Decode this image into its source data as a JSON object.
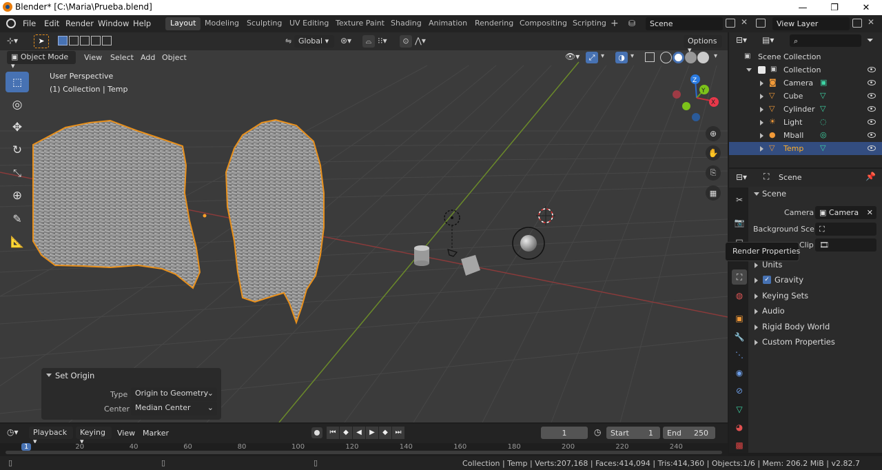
{
  "window": {
    "title": "Blender* [C:\\Maria\\Prueba.blend]",
    "minimize": "—",
    "restore": "❐",
    "close": "✕"
  },
  "menu": {
    "file": "File",
    "edit": "Edit",
    "render": "Render",
    "window": "Window",
    "help": "Help"
  },
  "workspaces": [
    "Layout",
    "Modeling",
    "Sculpting",
    "UV Editing",
    "Texture Paint",
    "Shading",
    "Animation",
    "Rendering",
    "Compositing",
    "Scripting"
  ],
  "active_workspace": "Layout",
  "scene_field": "Scene",
  "view_layer_field": "View Layer",
  "viewport_header": {
    "transform_orientation": "Global",
    "options": "Options",
    "mode": "Object Mode",
    "view": "View",
    "select": "Select",
    "add": "Add",
    "object": "Object"
  },
  "viewport_overlay": {
    "perspective": "User Perspective",
    "collection_info": "(1) Collection | Temp"
  },
  "gizmo": {
    "z": "Z",
    "y": "Y",
    "x": "X"
  },
  "set_origin": {
    "title": "Set Origin",
    "type_label": "Type",
    "type_value": "Origin to Geometry",
    "center_label": "Center",
    "center_value": "Median Center"
  },
  "outliner": {
    "scene_collection": "Scene Collection",
    "collection": "Collection",
    "items": [
      {
        "name": "Camera",
        "selected": false
      },
      {
        "name": "Cube",
        "selected": false
      },
      {
        "name": "Cylinder",
        "selected": false
      },
      {
        "name": "Light",
        "selected": false
      },
      {
        "name": "Mball",
        "selected": false
      },
      {
        "name": "Temp",
        "selected": true
      }
    ]
  },
  "properties": {
    "context": "Scene",
    "panel_title": "Scene",
    "camera_label": "Camera",
    "camera_value": "Camera",
    "background_label": "Background Sce..",
    "clip_label": "Clip",
    "units": "Units",
    "gravity": "Gravity",
    "keying_sets": "Keying Sets",
    "audio": "Audio",
    "rigid_body_world": "Rigid Body World",
    "custom_properties": "Custom Properties",
    "tooltip": "Render Properties"
  },
  "timeline": {
    "playback": "Playback",
    "keying": "Keying",
    "view": "View",
    "marker": "Marker",
    "current_frame": "1",
    "start_label": "Start",
    "start_value": "1",
    "end_label": "End",
    "end_value": "250",
    "ruler": [
      "1",
      "20",
      "40",
      "60",
      "80",
      "100",
      "120",
      "140",
      "160",
      "180",
      "200",
      "220",
      "240"
    ]
  },
  "status": {
    "text": "Collection | Temp | Verts:207,168 | Faces:414,094 | Tris:414,360 | Objects:1/6 | Mem: 206.2 MiB | v2.82.7"
  },
  "colors": {
    "selection_orange": "#ffaf29",
    "active_blue": "#4772b3",
    "x_axis": "#ff3352",
    "y_axis": "#8bdc00",
    "z_axis": "#2890ff",
    "mesh_green": "#3ed6a6"
  }
}
